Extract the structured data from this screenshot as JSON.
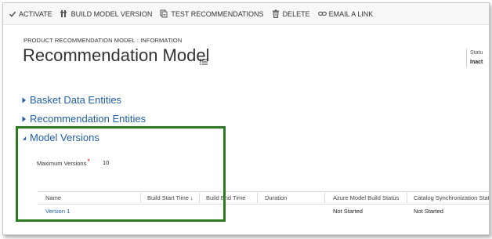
{
  "toolbar": {
    "items": [
      {
        "label": "ACTIVATE",
        "icon": "check-icon"
      },
      {
        "label": "BUILD MODEL VERSION",
        "icon": "build-icon"
      },
      {
        "label": "TEST RECOMMENDATIONS",
        "icon": "test-icon"
      },
      {
        "label": "DELETE",
        "icon": "trash-icon"
      },
      {
        "label": "EMAIL A LINK",
        "icon": "link-icon"
      }
    ]
  },
  "header": {
    "breadcrumb": "PRODUCT RECOMMENDATION MODEL : INFORMATION",
    "title": "Recommendation Model",
    "status_label": "Statu",
    "status_value": "Inact"
  },
  "sections": [
    {
      "label": "Basket Data Entities",
      "expanded": false
    },
    {
      "label": "Recommendation Entities",
      "expanded": false
    },
    {
      "label": "Model Versions",
      "expanded": true
    }
  ],
  "model_versions": {
    "max_versions_label": "Maximum Versions",
    "required_mark": "*",
    "max_versions_value": "10",
    "columns": [
      "Name",
      "Build Start Time ↓",
      "Build End Time",
      "Duration",
      "Azure Model Build Status",
      "Catalog Synchronization Statu"
    ],
    "rows": [
      {
        "name": "Version 1",
        "build_start_time": "",
        "build_end_time": "",
        "duration": "",
        "azure_model_build_status": "Not Started",
        "catalog_sync_status": "Not Started"
      }
    ]
  },
  "colors": {
    "accent": "#1f5ea8",
    "highlight_border": "#2a7a1f",
    "required": "#d01f1f"
  }
}
